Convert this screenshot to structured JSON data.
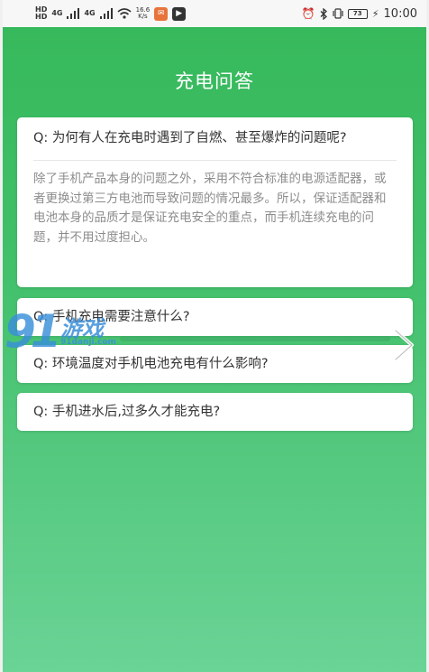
{
  "status_bar": {
    "sim1": "HD",
    "sim2": "HD",
    "net1": "4G",
    "net2": "4G",
    "speed_value": "16.6",
    "speed_unit": "K/s",
    "battery": "73",
    "time": "10:00"
  },
  "header": {
    "title": "充电问答"
  },
  "faq": [
    {
      "question": "Q:  为何有人在充电时遇到了自燃、甚至爆炸的问题呢?",
      "answer": "除了手机产品本身的问题之外，采用不符合标准的电源适配器，或者更换过第三方电池而导致问题的情况最多。所以，保证适配器和电池本身的品质才是保证充电安全的重点，而手机连续充电的问题，并不用过度担心。"
    },
    {
      "question": "Q:  手机充电需要注意什么?"
    },
    {
      "question": "Q:  环境温度对手机电池充电有什么影响?"
    },
    {
      "question": "Q:  手机进水后,过多久才能充电?"
    }
  ],
  "watermark": {
    "number": "91",
    "brand": "游戏",
    "url": "91danji.com"
  },
  "colors": {
    "green_top": "#35b85a",
    "green_bottom": "#6ad396",
    "watermark": "#3a8fd9"
  }
}
